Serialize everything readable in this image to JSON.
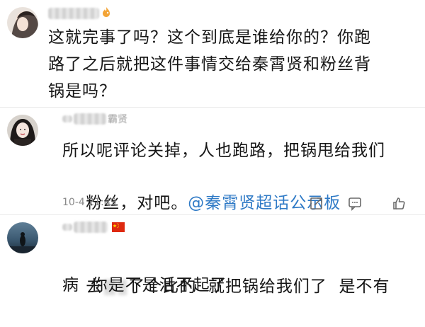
{
  "comments": [
    {
      "username_suffix": "",
      "text_line1": "这就完事了吗？这个到底是谁给你的？你跑",
      "text_line2": "路了之后就把这件事情交给秦霄贤和粉丝背",
      "text_line3": "锅是吗？"
    },
    {
      "username_suffix": "霸贤",
      "text_line1": "所以呢评论关掉，人也跑路，把锅甩给我们",
      "text_line2_plain": "粉丝，对吧。",
      "text_line2_tag": "@秦霄贤超话公示板",
      "timestamp": "10-4 21:49",
      "actions": [
        "share-icon",
        "comment-icon",
        "like-icon"
      ]
    },
    {
      "username_suffix": "",
      "text_line1_a": "去",
      "text_line1_b": "了个比的  就把锅给我们了  是不有",
      "text_line2": "病  你是不是活不起了"
    }
  ],
  "colors": {
    "tag": "#2f7ac6",
    "meta": "#8a8a8a",
    "text": "#161616",
    "divider": "#e9e9e9",
    "flag_red": "#de2910",
    "flag_yellow": "#ffde00",
    "emoji_orange": "#f3a436"
  }
}
